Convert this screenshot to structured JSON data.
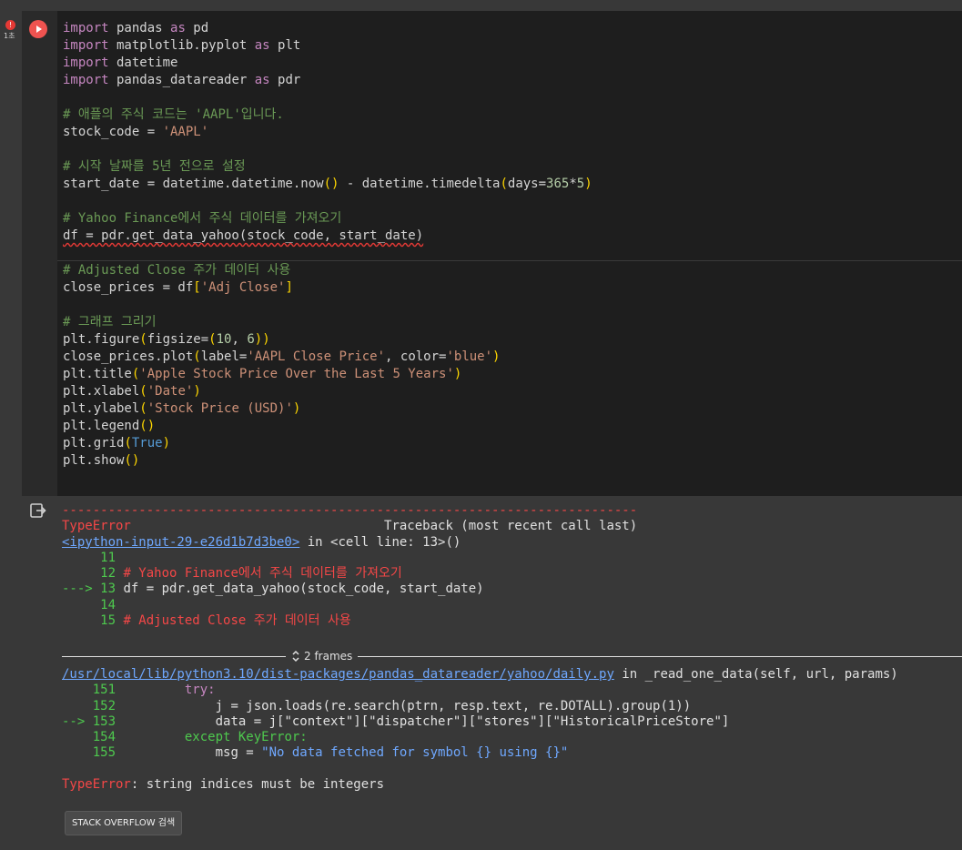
{
  "cell": {
    "error_badge": "!",
    "exec_time": "1초"
  },
  "code": {
    "l1_kw": "import",
    "l1_mod": " pandas ",
    "l1_as": "as",
    "l1_alias": " pd",
    "l2_kw": "import",
    "l2_mod": " matplotlib.pyplot ",
    "l2_as": "as",
    "l2_alias": " plt",
    "l3_kw": "import",
    "l3_mod": " datetime",
    "l4_kw": "import",
    "l4_mod": " pandas_datareader ",
    "l4_as": "as",
    "l4_alias": " pdr",
    "l6": "# 애플의 주식 코드는 'AAPL'입니다.",
    "l7_a": "stock_code = ",
    "l7_s": "'AAPL'",
    "l9": "# 시작 날짜를 5년 전으로 설정",
    "l10_a": "start_date = datetime.datetime.now",
    "l10_b1": "()",
    "l10_c": " - datetime.timedelta",
    "l10_b2": "(",
    "l10_d": "days=",
    "l10_n1": "365",
    "l10_e": "*",
    "l10_n2": "5",
    "l10_b3": ")",
    "l12": "# Yahoo Finance에서 주식 데이터를 가져오기",
    "l13": "df = pdr.get_data_yahoo(stock_code, start_date)",
    "l15": "# Adjusted Close 주가 데이터 사용",
    "l16_a": "close_prices = df",
    "l16_b1": "[",
    "l16_s": "'Adj Close'",
    "l16_b2": "]",
    "l18": "# 그래프 그리기",
    "l19_a": "plt.figure",
    "l19_b1": "(",
    "l19_c": "figsize=",
    "l19_b2": "(",
    "l19_n1": "10",
    "l19_d": ", ",
    "l19_n2": "6",
    "l19_b3": "))",
    "l20_a": "close_prices.plot",
    "l20_b1": "(",
    "l20_c": "label=",
    "l20_s1": "'AAPL Close Price'",
    "l20_d": ", color=",
    "l20_s2": "'blue'",
    "l20_b2": ")",
    "l21_a": "plt.title",
    "l21_b1": "(",
    "l21_s": "'Apple Stock Price Over the Last 5 Years'",
    "l21_b2": ")",
    "l22_a": "plt.xlabel",
    "l22_b1": "(",
    "l22_s": "'Date'",
    "l22_b2": ")",
    "l23_a": "plt.ylabel",
    "l23_b1": "(",
    "l23_s": "'Stock Price (USD)'",
    "l23_b2": ")",
    "l24_a": "plt.legend",
    "l24_b": "()",
    "l25_a": "plt.grid",
    "l25_b1": "(",
    "l25_k": "True",
    "l25_b2": ")",
    "l26_a": "plt.show",
    "l26_b": "()"
  },
  "output": {
    "dashes": "---------------------------------------------------------------------------",
    "err_type": "TypeError",
    "traceback_pad": "                                 ",
    "traceback_label": "Traceback (most recent call last)",
    "input_link": "<ipython-input-29-e26d1b7d3be0>",
    "in_cell": " in <cell line: 13>()",
    "t1": "     11",
    "t2_num": "     12 ",
    "t2_cm": "# Yahoo Finance에서 주식 데이터를 가져오기",
    "t3_arrow": "---> 13 ",
    "t3_code": "df = pdr.get_data_yahoo(stock_code, start_date)",
    "t4": "     14",
    "t5_num": "     15 ",
    "t5_cm": "# Adjusted Close 주가 데이터 사용",
    "frames_label": "2 frames",
    "file_link": "/usr/local/lib/python3.10/dist-packages/pandas_datareader/yahoo/daily.py",
    "in_func": " in _read_one_data(self, url, params)",
    "f1_num": "    151 ",
    "f1_code": "        try:",
    "f2_num": "    152 ",
    "f2_code": "            j = json.loads(re.search(ptrn, resp.text, re.DOTALL).group(1))",
    "f3_arrow": "--> 153 ",
    "f3_code": "            data = j[\"context\"][\"dispatcher\"][\"stores\"][\"HistoricalPriceStore\"]",
    "f4_num": "    154 ",
    "f4_code": "        except KeyError:",
    "f5_num": "    155 ",
    "f5_a": "            msg = ",
    "f5_s": "\"No data fetched for symbol {} using {}\"",
    "final_type": "TypeError",
    "final_msg": ": string indices must be integers",
    "so_button": "STACK OVERFLOW 검색"
  }
}
